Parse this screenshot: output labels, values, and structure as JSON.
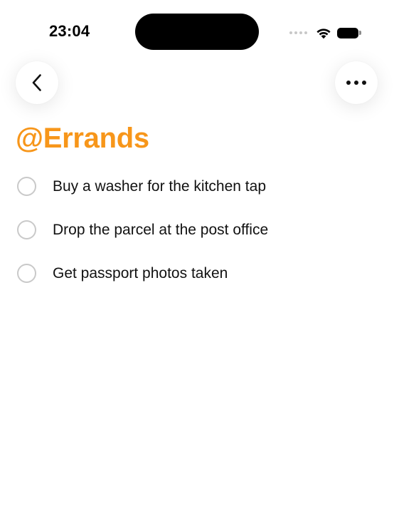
{
  "status_bar": {
    "time": "23:04",
    "icons": [
      "cellular-signal-icon",
      "wifi-icon",
      "battery-icon"
    ]
  },
  "navigation": {
    "back_icon": "chevron-left-icon",
    "more_icon": "ellipsis-icon"
  },
  "list": {
    "title": "@Errands",
    "accent_color": "#F7961A",
    "tasks": [
      {
        "label": "Buy a washer for the kitchen tap",
        "completed": false
      },
      {
        "label": "Drop the parcel at the post office",
        "completed": false
      },
      {
        "label": "Get passport photos taken",
        "completed": false
      }
    ]
  }
}
